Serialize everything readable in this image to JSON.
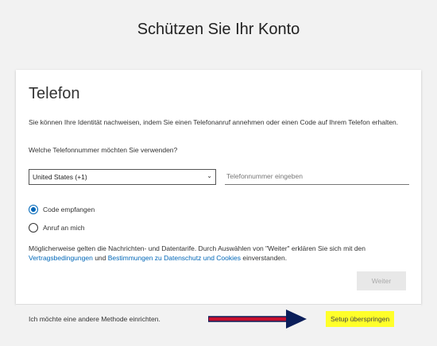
{
  "header": {
    "title": "Schützen Sie Ihr Konto"
  },
  "section": {
    "heading": "Telefon",
    "intro": "Sie können Ihre Identität nachweisen, indem Sie einen Telefonanruf annehmen oder einen Code auf Ihrem Telefon erhalten.",
    "question": "Welche Telefonnummer möchten Sie verwenden?"
  },
  "form": {
    "country_value": "United States (+1)",
    "phone_placeholder": "Telefonnummer eingeben",
    "options": [
      {
        "label": "Code empfangen",
        "selected": true
      },
      {
        "label": "Anruf an mich",
        "selected": false
      }
    ]
  },
  "legal": {
    "part1": "Möglicherweise gelten die Nachrichten- und Datentarife. Durch Auswählen von \"Weiter\" erklären Sie sich mit den ",
    "link1": "Vertragsbedingungen",
    "part2": " und ",
    "link2": "Bestimmungen zu Datenschutz und Cookies",
    "part3": " einverstanden."
  },
  "actions": {
    "next_label": "Weiter",
    "alt_method_label": "Ich möchte eine andere Methode einrichten.",
    "skip_label": "Setup überspringen"
  },
  "colors": {
    "accent": "#0067b8",
    "highlight": "#ffff2a",
    "arrow_red": "#c8102e",
    "arrow_navy": "#0b1e5a"
  },
  "icons": {
    "select_chevron": "chevron-down-icon",
    "annotation_arrow": "arrow-right-icon"
  }
}
